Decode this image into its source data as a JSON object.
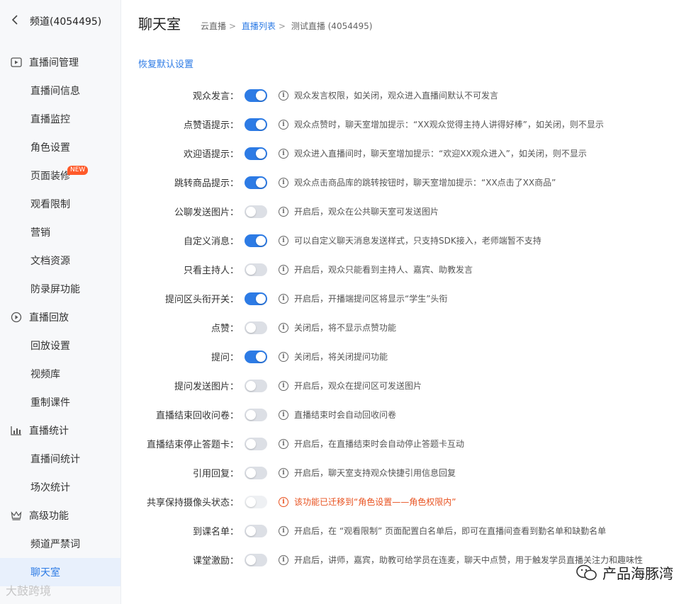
{
  "sidebar": {
    "header": {
      "back_icon": "chevron-left-icon",
      "label": "频道(4054495)"
    },
    "groups": [
      {
        "label": "直播间管理",
        "icon": "play-square-icon",
        "items": [
          {
            "label": "直播间信息"
          },
          {
            "label": "直播监控"
          },
          {
            "label": "角色设置"
          },
          {
            "label": "页面装修",
            "badge": "NEW"
          },
          {
            "label": "观看限制"
          },
          {
            "label": "营销"
          },
          {
            "label": "文档资源"
          },
          {
            "label": "防录屏功能"
          }
        ]
      },
      {
        "label": "直播回放",
        "icon": "replay-icon",
        "items": [
          {
            "label": "回放设置"
          },
          {
            "label": "视频库"
          },
          {
            "label": "重制课件"
          }
        ]
      },
      {
        "label": "直播统计",
        "icon": "bar-chart-icon",
        "items": [
          {
            "label": "直播间统计"
          },
          {
            "label": "场次统计"
          }
        ]
      },
      {
        "label": "高级功能",
        "icon": "crown-icon",
        "items": [
          {
            "label": "频道严禁词"
          },
          {
            "label": "聊天室",
            "active": true
          }
        ]
      }
    ]
  },
  "header": {
    "title": "聊天室",
    "breadcrumb": [
      {
        "label": "云直播",
        "link": false
      },
      {
        "label": "直播列表",
        "link": true
      },
      {
        "label": "测试直播 (4054495)",
        "link": false
      }
    ]
  },
  "restore_label": "恢复默认设置",
  "settings": [
    {
      "label": "观众发言：",
      "state": "on",
      "desc": "观众发言权限，如关闭，观众进入直播间默认不可发言"
    },
    {
      "label": "点赞语提示：",
      "state": "on",
      "desc": "观众点赞时，聊天室增加提示：“XX观众觉得主持人讲得好棒”，如关闭，则不显示"
    },
    {
      "label": "欢迎语提示：",
      "state": "on",
      "desc": "观众进入直播间时，聊天室增加提示：“欢迎XX观众进入”，如关闭，则不显示"
    },
    {
      "label": "跳转商品提示：",
      "state": "on",
      "desc": "观众点击商品库的跳转按钮时，聊天室增加提示：“XX点击了XX商品”"
    },
    {
      "label": "公聊发送图片：",
      "state": "off",
      "desc": "开启后，观众在公共聊天室可发送图片"
    },
    {
      "label": "自定义消息：",
      "state": "on",
      "desc": "可以自定义聊天消息发送样式，只支持SDK接入，老师端暂不支持"
    },
    {
      "label": "只看主持人：",
      "state": "off",
      "desc": "开启后，观众只能看到主持人、嘉宾、助教发言"
    },
    {
      "label": "提问区头衔开关：",
      "state": "on",
      "desc": "开启后，开播端提问区将显示“学生”头衔"
    },
    {
      "label": "点赞：",
      "state": "off",
      "desc": "关闭后，将不显示点赞功能"
    },
    {
      "label": "提问：",
      "state": "on",
      "desc": "关闭后，将关闭提问功能"
    },
    {
      "label": "提问发送图片：",
      "state": "off",
      "desc": "开启后，观众在提问区可发送图片"
    },
    {
      "label": "直播结束回收问卷：",
      "state": "off",
      "desc": "直播结束时会自动回收问卷"
    },
    {
      "label": "直播结束停止答题卡：",
      "state": "off",
      "desc": "开启后，在直播结束时会自动停止答题卡互动"
    },
    {
      "label": "引用回复：",
      "state": "off",
      "desc": "开启后，聊天室支持观众快捷引用信息回复"
    },
    {
      "label": "共享保持摄像头状态：",
      "state": "disabled",
      "warn": true,
      "desc": "该功能已迁移到“角色设置——角色权限内”"
    },
    {
      "label": "到课名单：",
      "state": "off",
      "desc": "开启后，在 “观看限制” 页面配置白名单后，即可在直播间查看到勤名单和缺勤名单"
    },
    {
      "label": "课堂激励：",
      "state": "off",
      "desc": "开启后，讲师，嘉宾，助教可给学员在连麦，聊天中点赞，用于触发学员直播关注力和趣味性"
    }
  ],
  "watermarks": {
    "right": "产品海豚湾",
    "left": "大鼓跨境"
  },
  "colors": {
    "accent": "#2d7be5",
    "warn": "#e8511f",
    "badge": "#ff5a2a"
  }
}
